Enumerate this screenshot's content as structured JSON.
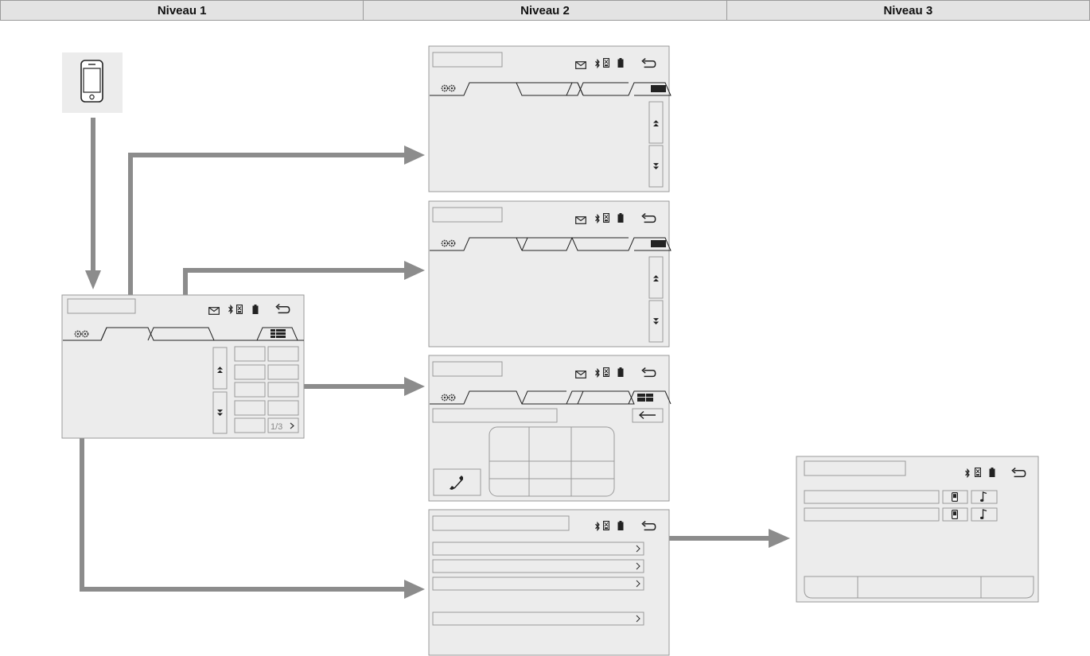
{
  "header": {
    "columns": [
      "Niveau 1",
      "Niveau 2",
      "Niveau 3"
    ]
  },
  "level1_screen": {
    "page_indicator": "1/3"
  },
  "icons": {
    "phone": "smartphone-icon",
    "settings": "gears-icon",
    "message": "envelope-icon",
    "bluetooth": "bluetooth-icon",
    "sim": "sim-card-icon",
    "battery": "battery-icon",
    "back": "return-arrow-icon",
    "scroll_up": "double-arrow-up-icon",
    "scroll_down": "double-arrow-down-icon",
    "grid": "grid-menu-icon",
    "call": "handset-icon",
    "delete": "left-arrow-icon",
    "note": "music-note-icon",
    "row_chevron": "chevron-right-icon"
  },
  "colors": {
    "screen_bg": "#ececec",
    "screen_border": "#9a9a9a",
    "arrow": "#8c8c8c",
    "header_bg": "#e3e3e3"
  }
}
